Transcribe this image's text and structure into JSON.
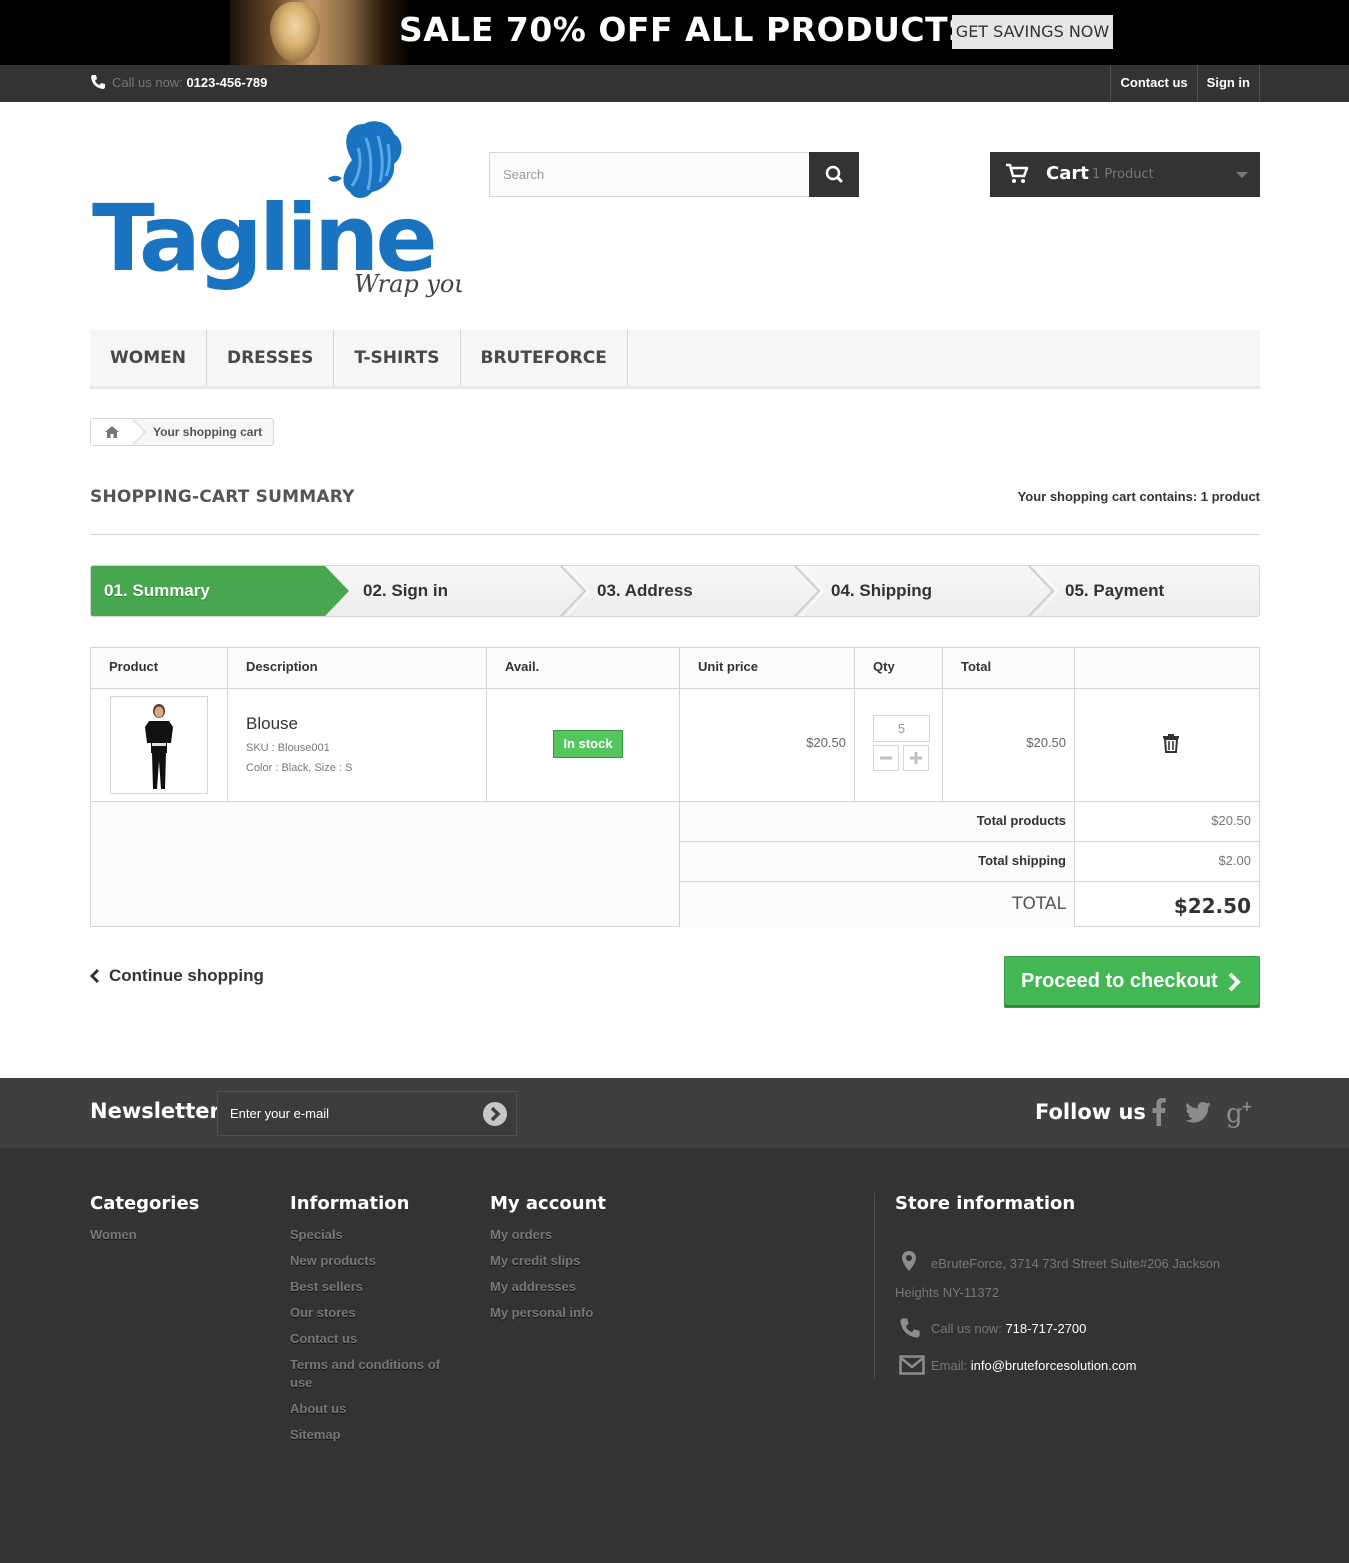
{
  "promo": {
    "headline": "SALE 70% OFF ALL PRODUCTS",
    "cta_label": "GET SAVINGS NOW"
  },
  "topbar": {
    "call_label": "Call us now:",
    "phone": "0123-456-789",
    "contact_label": "Contact us",
    "signin_label": "Sign in"
  },
  "logo": {
    "brand": "Tagline",
    "slogan": "Wrap you",
    "color": "#1a73c0"
  },
  "search": {
    "placeholder": "Search"
  },
  "cart": {
    "label": "Cart",
    "count_text": "1 Product"
  },
  "menu": {
    "items": [
      "WOMEN",
      "DRESSES",
      "T-SHIRTS",
      "BRUTEFORCE"
    ]
  },
  "breadcrumb": {
    "current": "Your shopping cart"
  },
  "page": {
    "title": "SHOPPING-CART SUMMARY",
    "count_text": "Your shopping cart contains: 1 product"
  },
  "steps": [
    "01. Summary",
    "02. Sign in",
    "03. Address",
    "04. Shipping",
    "05. Payment"
  ],
  "table": {
    "headers": [
      "Product",
      "Description",
      "Avail.",
      "Unit price",
      "Qty",
      "Total",
      ""
    ],
    "row": {
      "name": "Blouse",
      "sku": "SKU : Blouse001",
      "attributes": "Color : Black, Size : S",
      "availability": "In stock",
      "unit_price": "$20.50",
      "qty": "5",
      "total": "$20.50"
    },
    "summary": {
      "total_products_label": "Total products",
      "total_products": "$20.50",
      "total_shipping_label": "Total shipping",
      "total_shipping": "$2.00",
      "total_label": "TOTAL",
      "total": "$22.50"
    }
  },
  "actions": {
    "continue_label": "Continue shopping",
    "checkout_label": "Proceed to checkout"
  },
  "newsletter": {
    "title": "Newsletter",
    "placeholder": "Enter your e-mail",
    "follow_label": "Follow us"
  },
  "footer": {
    "categories": {
      "title": "Categories",
      "links": [
        "Women"
      ]
    },
    "information": {
      "title": "Information",
      "links": [
        "Specials",
        "New products",
        "Best sellers",
        "Our stores",
        "Contact us",
        "Terms and conditions of use",
        "About us",
        "Sitemap"
      ]
    },
    "account": {
      "title": "My account",
      "links": [
        "My orders",
        "My credit slips",
        "My addresses",
        "My personal info"
      ]
    },
    "store": {
      "title": "Store information",
      "address": "eBruteForce, 3714 73rd Street Suite#206 Jackson Heights NY-11372",
      "call_label": "Call us now:",
      "phone": "718-717-2700",
      "email_label": "Email:",
      "email": "info@bruteforcesolution.com"
    }
  },
  "colors": {
    "accent_green": "#46a74e",
    "dark": "#333333",
    "stock_green": "#55c65e"
  }
}
